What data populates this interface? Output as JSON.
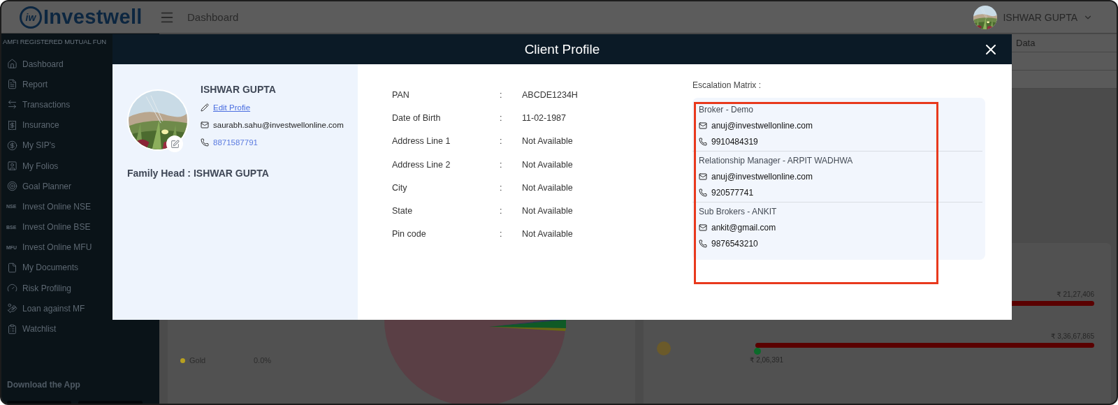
{
  "header": {
    "logo_mark": "iw",
    "logo_text": "Investwell",
    "page_title": "Dashboard",
    "user_name": "ISHWAR GUPTA"
  },
  "user_menu": {
    "items": [
      "Data"
    ]
  },
  "sidebar": {
    "tagline": "AMFI REGISTERED MUTUAL FUN",
    "items": [
      {
        "label": "Dashboard"
      },
      {
        "label": "Report"
      },
      {
        "label": "Transactions"
      },
      {
        "label": "Insurance"
      },
      {
        "label": "My SIP's"
      },
      {
        "label": "My Folios"
      },
      {
        "label": "Goal Planner"
      },
      {
        "label": "Invest Online NSE",
        "badge": "NSE"
      },
      {
        "label": "Invest Online BSE",
        "badge": "BSE"
      },
      {
        "label": "Invest Online MFU",
        "badge": "MFU"
      },
      {
        "label": "My Documents"
      },
      {
        "label": "Risk Profiling"
      },
      {
        "label": "Loan against MF"
      },
      {
        "label": "Watchlist"
      }
    ],
    "download_title": "Download the App"
  },
  "allocation": {
    "rows": [
      {
        "name": "Gold",
        "value": "0.0%",
        "color": "#b8a020"
      }
    ]
  },
  "goals": {
    "amounts": [
      "₹ 21,27,406",
      "₹ 3,36,67,865"
    ],
    "achieved": "₹ 2,06,391"
  },
  "modal": {
    "title": "Client Profile",
    "profile": {
      "name": "ISHWAR GUPTA",
      "edit_link": "Edit Profie",
      "email": "saurabh.sahu@investwellonline.com",
      "phone": "8871587791",
      "family_head": "Family Head : ISHWAR GUPTA"
    },
    "details": [
      {
        "label": "PAN",
        "sep": ":",
        "value": "ABCDE1234H"
      },
      {
        "label": "Date of Birth",
        "sep": ":",
        "value": "11-02-1987"
      },
      {
        "label": "Address Line 1",
        "sep": ":",
        "value": "Not Available"
      },
      {
        "label": "Address Line 2",
        "sep": ":",
        "value": "Not Available"
      },
      {
        "label": "City",
        "sep": ":",
        "value": "Not Available"
      },
      {
        "label": "State",
        "sep": ":",
        "value": "Not Available"
      },
      {
        "label": "Pin code",
        "sep": ":",
        "value": "Not Available"
      }
    ],
    "escalation": {
      "title": "Escalation Matrix :",
      "highlighted": true,
      "contacts": [
        {
          "role": "Broker - Demo",
          "email": "anuj@investwellonline.com",
          "phone": "9910484319"
        },
        {
          "role": "Relationship Manager - ARPIT WADHWA",
          "email": "anuj@investwellonline.com",
          "phone": "920577741"
        },
        {
          "role": "Sub Brokers - ANKIT",
          "email": "ankit@gmail.com",
          "phone": "9876543210"
        }
      ]
    }
  }
}
